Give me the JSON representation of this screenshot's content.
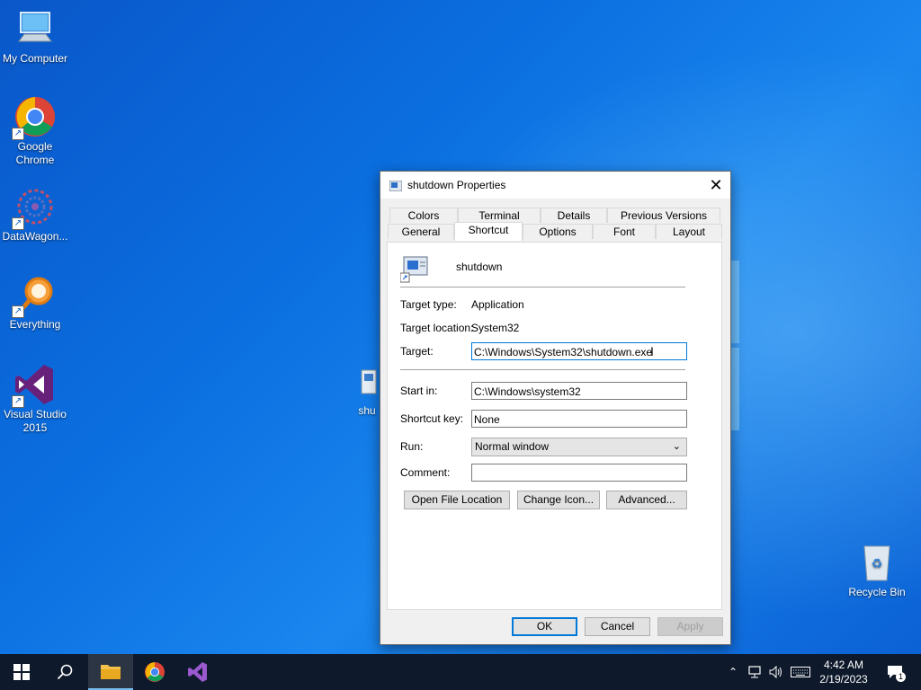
{
  "desktop": {
    "icons": [
      {
        "label": "My Computer"
      },
      {
        "label": "Google Chrome"
      },
      {
        "label": "DataWagon..."
      },
      {
        "label": "Everything"
      },
      {
        "label": "Visual Studio 2015"
      },
      {
        "label": "shu"
      },
      {
        "label": "Recycle Bin"
      }
    ]
  },
  "dialog": {
    "title": "shutdown Properties",
    "tabs_row1": [
      "Colors",
      "Terminal",
      "Details",
      "Previous Versions"
    ],
    "tabs_row2": [
      "General",
      "Shortcut",
      "Options",
      "Font",
      "Layout"
    ],
    "active_tab": "Shortcut",
    "shortcut_name": "shutdown",
    "target_type_label": "Target type:",
    "target_type_value": "Application",
    "target_location_label": "Target location:",
    "target_location_value": "System32",
    "target_label": "Target:",
    "target_value": "C:\\Windows\\System32\\shutdown.exe",
    "start_in_label": "Start in:",
    "start_in_value": "C:\\Windows\\system32",
    "shortcut_key_label": "Shortcut key:",
    "shortcut_key_value": "None",
    "run_label": "Run:",
    "run_value": "Normal window",
    "comment_label": "Comment:",
    "comment_value": "",
    "buttons": {
      "open_file_location": "Open File Location",
      "change_icon": "Change Icon...",
      "advanced": "Advanced...",
      "ok": "OK",
      "cancel": "Cancel",
      "apply": "Apply"
    }
  },
  "taskbar": {
    "time": "4:42 AM",
    "date": "2/19/2023",
    "notification_count": "1"
  },
  "colors": {
    "accent": "#0078d7",
    "taskbar": "#0e1a2b"
  }
}
